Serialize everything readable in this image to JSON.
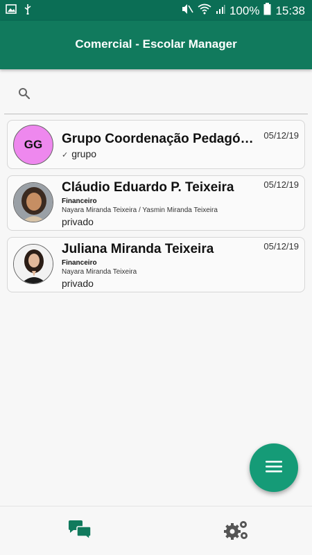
{
  "status_bar": {
    "battery": "100%",
    "time": "15:38"
  },
  "app_bar": {
    "title": "Comercial - Escolar Manager"
  },
  "search": {
    "placeholder": "",
    "value": ""
  },
  "chats": [
    {
      "initials": "GG",
      "name": "Grupo Coordenação Pedagógica",
      "date": "05/12/19",
      "subtitle": "grupo",
      "avatar_color": "#ee88ee"
    },
    {
      "name": "Cláudio Eduardo P. Teixeira",
      "date": "05/12/19",
      "role": "Financeiro",
      "members": "Nayara Miranda Teixeira / Yasmin Miranda Teixeira",
      "type": "privado"
    },
    {
      "name": "Juliana Miranda Teixeira",
      "date": "05/12/19",
      "role": "Financeiro",
      "members": "Nayara Miranda Teixeira",
      "type": "privado"
    }
  ],
  "fab": {
    "icon": "menu-icon"
  },
  "bottom_nav": {
    "items": [
      {
        "icon": "chat-icon",
        "active": true
      },
      {
        "icon": "settings-gears-icon",
        "active": false
      }
    ]
  },
  "colors": {
    "status_bar": "#0b6e55",
    "app_bar": "#117a5d",
    "accent": "#159b77",
    "nav_active": "#117a5d",
    "nav_inactive": "#555555"
  }
}
